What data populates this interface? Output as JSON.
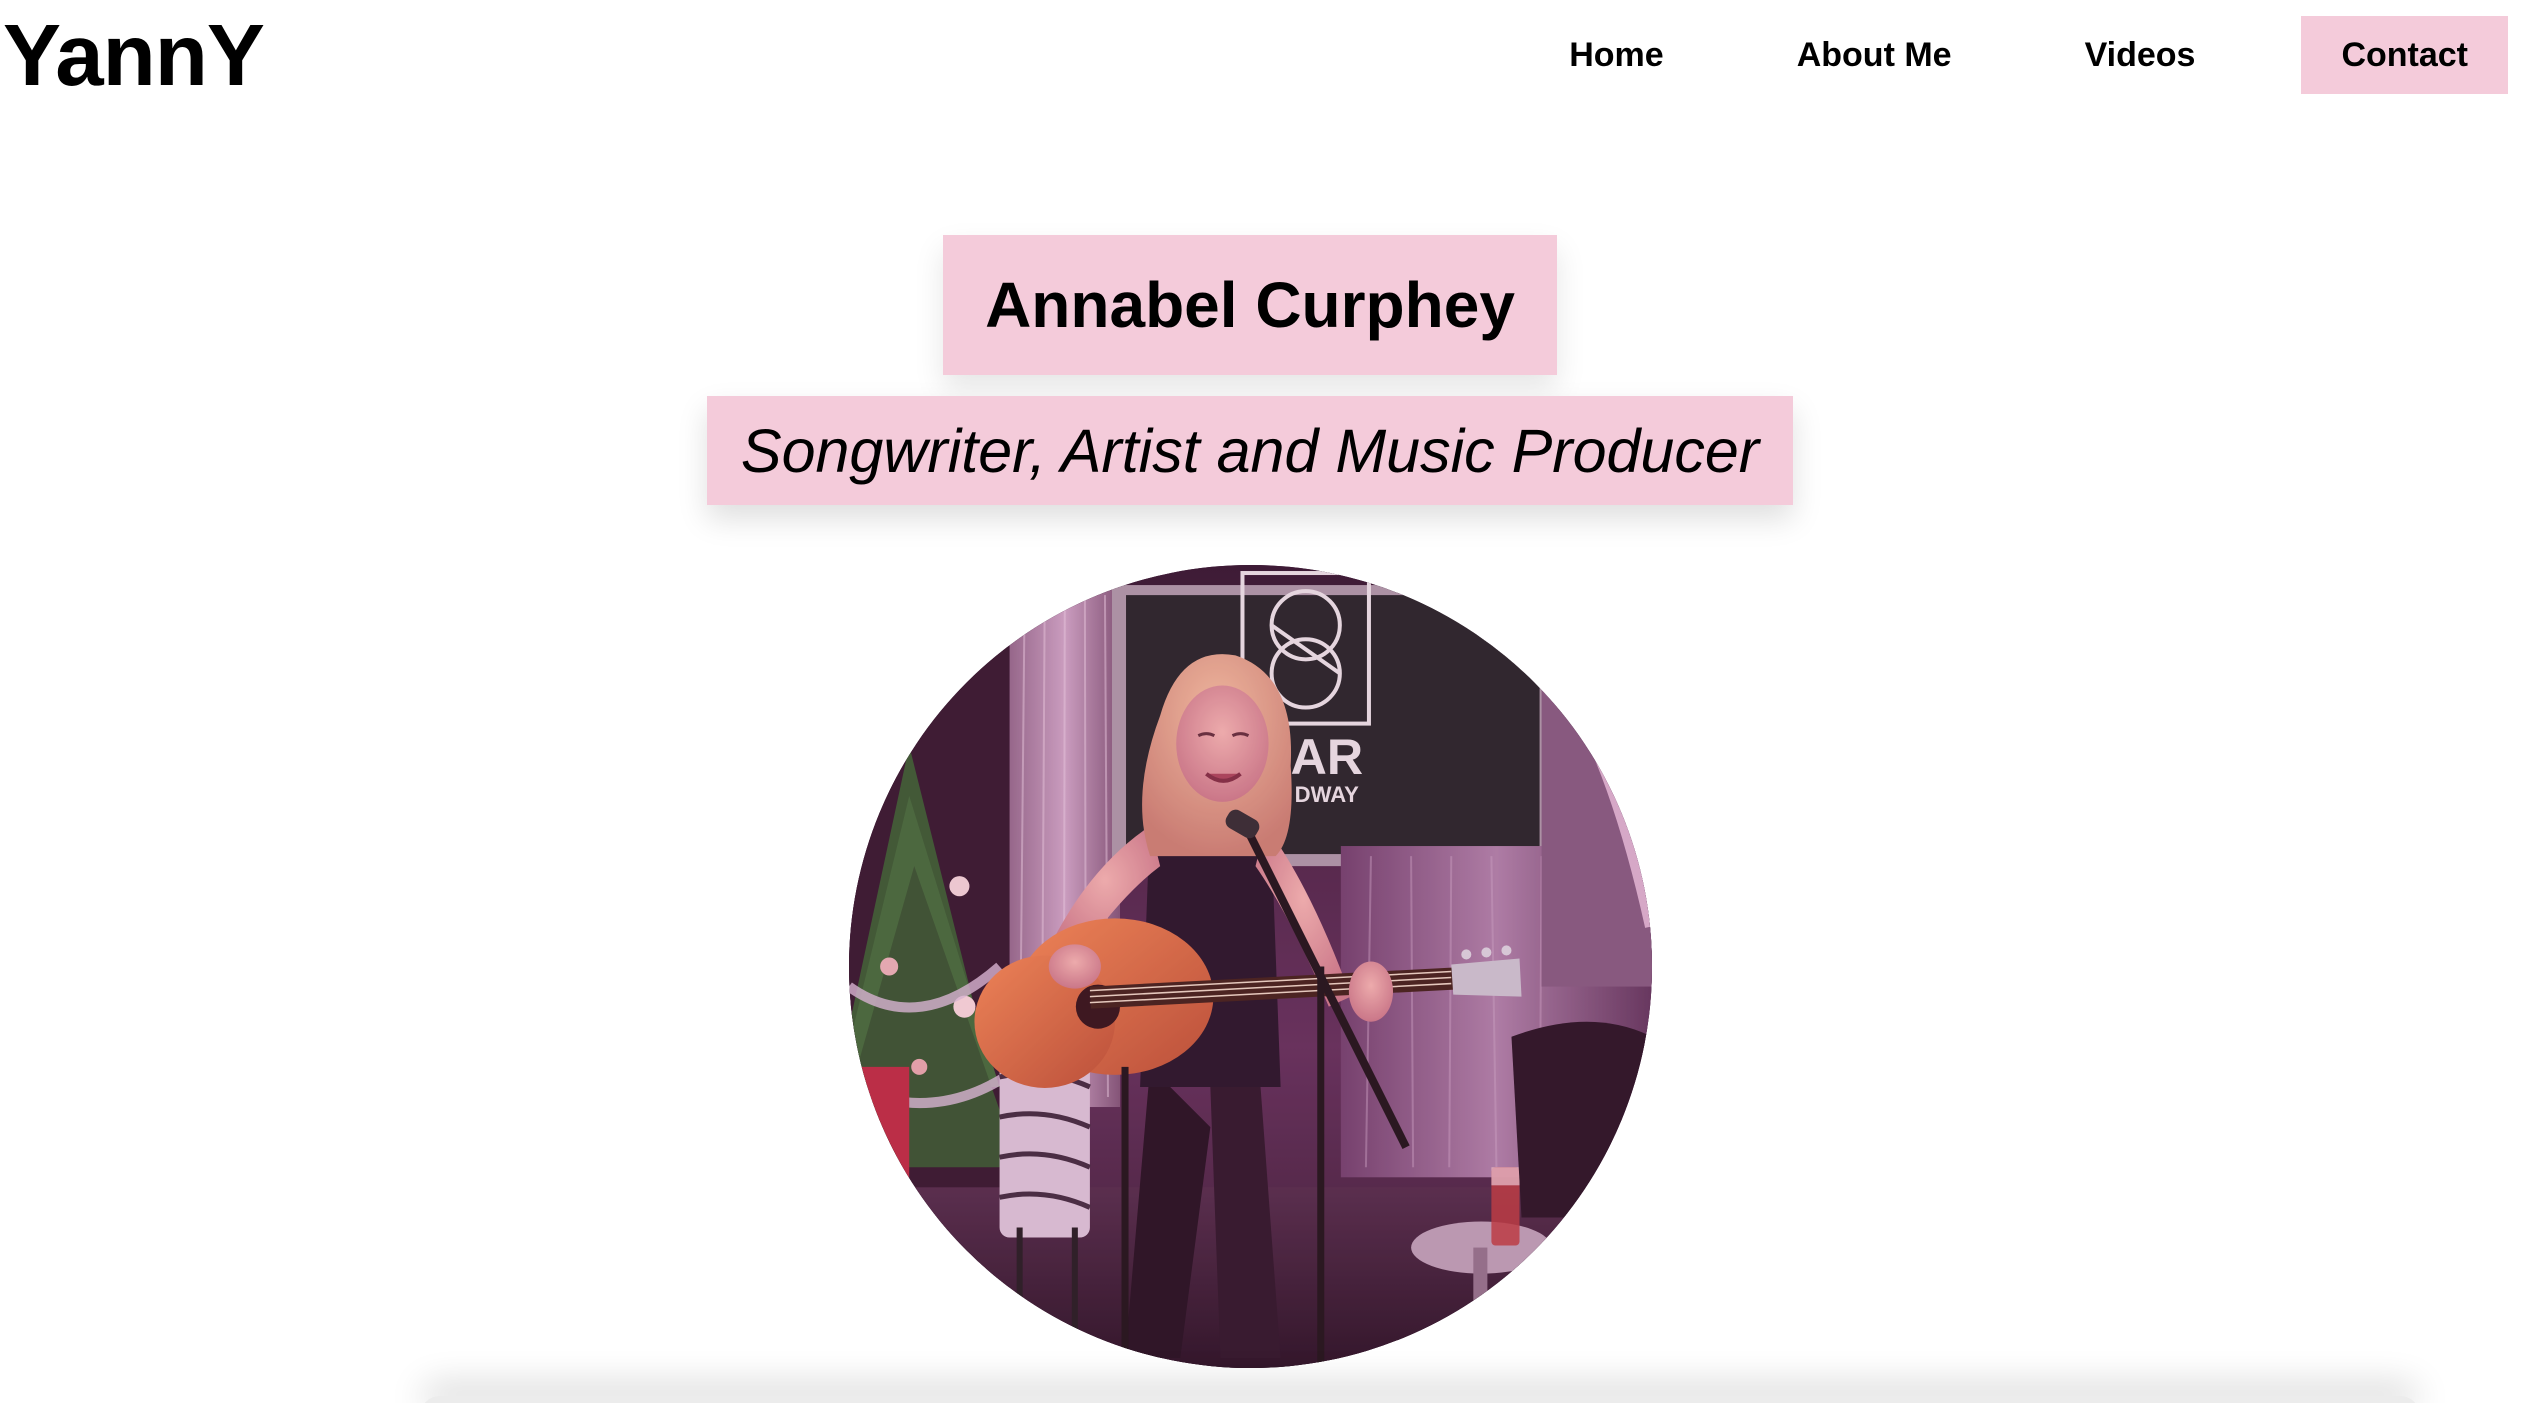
{
  "header": {
    "logo": "YannY",
    "nav": [
      {
        "label": "Home"
      },
      {
        "label": "About Me"
      },
      {
        "label": "Videos"
      },
      {
        "label": "Contact",
        "active": true
      }
    ]
  },
  "hero": {
    "name": "Annabel Curphey",
    "tagline": "Songwriter, Artist and Music Producer",
    "photo_alt": "Annabel Curphey performing with an acoustic guitar at a microphone on stage",
    "photo_sign_text": "AR",
    "photo_sign_subtext": "DWAY"
  },
  "colors": {
    "accent_pink": "#f4cbda",
    "text": "#000000",
    "background": "#ffffff"
  }
}
